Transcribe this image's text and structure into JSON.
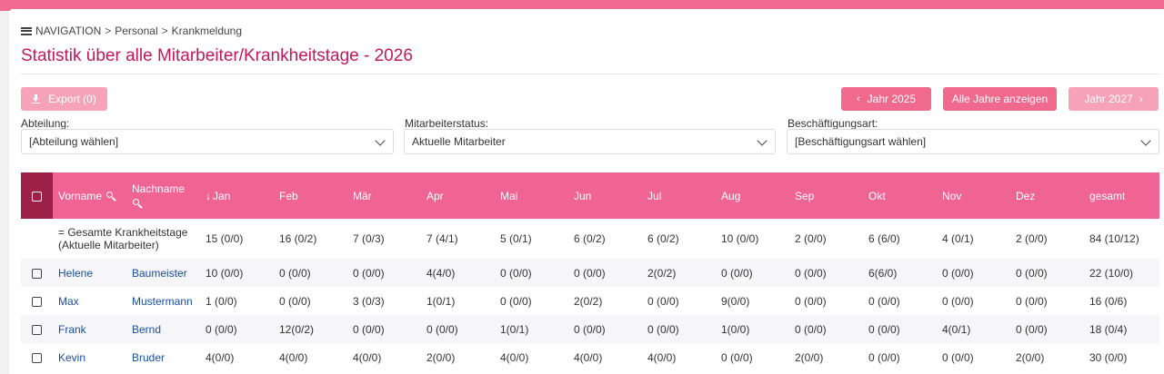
{
  "breadcrumb": {
    "root": "NAVIGATION",
    "sep": ">",
    "items": [
      "Personal",
      "Krankmeldung"
    ]
  },
  "page": {
    "title": "Statistik über alle Mitarbeiter/Krankheitstage - 2026"
  },
  "toolbar": {
    "export_label": "Export (0)",
    "prev_year_label": "Jahr 2025",
    "all_years_label": "Alle Jahre anzeigen",
    "next_year_label": "Jahr 2027",
    "prev_chevron": "‹",
    "next_chevron": "›"
  },
  "filters": [
    {
      "label": "Abteilung:",
      "value": "[Abteilung wählen]"
    },
    {
      "label": "Mitarbeiterstatus:",
      "value": "Aktuelle Mitarbeiter"
    },
    {
      "label": "Beschäftigungsart:",
      "value": "[Beschäftigungsart wählen]"
    }
  ],
  "colors": {
    "accent": "#ef6492",
    "accent_dark": "#9e2046",
    "title": "#c2185b",
    "link": "#1a4fa0"
  },
  "table": {
    "headers": {
      "first": "Vorname",
      "last": "Nachname",
      "sort_arrow": "↓",
      "months": [
        "Jan",
        "Feb",
        "Mär",
        "Apr",
        "Mai",
        "Jun",
        "Jul",
        "Aug",
        "Sep",
        "Okt",
        "Nov",
        "Dez"
      ],
      "total": "gesamt"
    },
    "summary": {
      "label_line1": "= Gesamte Krankheitstage",
      "label_line2": "(Aktuelle Mitarbeiter)",
      "values": [
        "15 (0/0)",
        "16 (0/2)",
        "7 (0/3)",
        "7 (4/1)",
        "5 (0/1)",
        "6 (0/2)",
        "6 (0/2)",
        "10 (0/0)",
        "2 (0/0)",
        "6 (6/0)",
        "4 (0/1)",
        "2 (0/0)",
        "84 (10/12)"
      ]
    },
    "rows": [
      {
        "first": "Helene",
        "last": "Baumeister",
        "values": [
          "10 (0/0)",
          "0 (0/0)",
          "0 (0/0)",
          "4(4/0)",
          "0 (0/0)",
          "0 (0/0)",
          "2(0/2)",
          "0 (0/0)",
          "0 (0/0)",
          "6(6/0)",
          "0 (0/0)",
          "0 (0/0)",
          "22 (10/0)"
        ]
      },
      {
        "first": "Max",
        "last": "Mustermann",
        "values": [
          "1 (0/0)",
          "0 (0/0)",
          "3 (0/3)",
          "1(0/1)",
          "0 (0/0)",
          "2(0/2)",
          "0 (0/0)",
          "9(0/0)",
          "0 (0/0)",
          "0 (0/0)",
          "0 (0/0)",
          "0 (0/0)",
          "16 (0/6)"
        ]
      },
      {
        "first": "Frank",
        "last": "Bernd",
        "values": [
          "0 (0/0)",
          "12(0/2)",
          "0 (0/0)",
          "0 (0/0)",
          "1(0/1)",
          "0 (0/0)",
          "0 (0/0)",
          "1(0/0)",
          "0 (0/0)",
          "0 (0/0)",
          "4(0/1)",
          "0 (0/0)",
          "18 (0/4)"
        ]
      },
      {
        "first": "Kevin",
        "last": "Bruder",
        "values": [
          "4(0/0)",
          "4(0/0)",
          "4(0/0)",
          "2(0/0)",
          "4(0/0)",
          "4(0/0)",
          "4(0/0)",
          "0 (0/0)",
          "2(0/0)",
          "0 (0/0)",
          "0 (0/0)",
          "2(0/0)",
          "30 (0/0)"
        ]
      }
    ]
  }
}
